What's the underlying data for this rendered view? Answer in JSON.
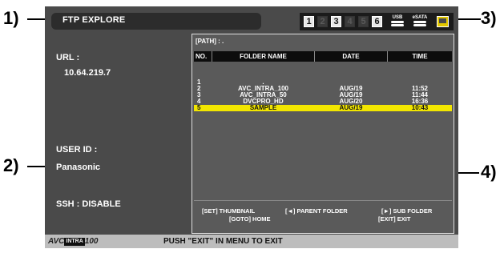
{
  "callouts": {
    "c1": "1)",
    "c2": "2)",
    "c3": "3)",
    "c4": "4)"
  },
  "title": "FTP EXPLORE",
  "status": {
    "slots": [
      {
        "label": "1",
        "active": true
      },
      {
        "label": "2",
        "active": false
      },
      {
        "label": "3",
        "active": true
      },
      {
        "label": "4",
        "active": false
      },
      {
        "label": "5",
        "active": false
      },
      {
        "label": "6",
        "active": true
      }
    ],
    "usb_label": "USB",
    "esata_label": "eSATA",
    "accent_color": "#e3c800"
  },
  "info": {
    "url_label": "URL :",
    "url_value": "10.64.219.7",
    "user_label": "USER ID :",
    "user_value": "Panasonic",
    "ssh_label": "SSH : DISABLE"
  },
  "browser": {
    "path": "[PATH] : .",
    "columns": [
      "NO.",
      "FOLDER NAME",
      "DATE",
      "TIME"
    ],
    "rows": [
      {
        "no": "1",
        "name": ".",
        "date": "",
        "time": "",
        "selected": false
      },
      {
        "no": "2",
        "name": "AVC_INTRA_100",
        "date": "AUG/19",
        "time": "11:52",
        "selected": false
      },
      {
        "no": "3",
        "name": "AVC_INTRA_50",
        "date": "AUG/19",
        "time": "11:44",
        "selected": false
      },
      {
        "no": "4",
        "name": "DVCPRO_HD",
        "date": "AUG/20",
        "time": "16:36",
        "selected": false
      },
      {
        "no": "5",
        "name": "SAMPLE",
        "date": "AUG/19",
        "time": "10:43",
        "selected": true
      }
    ],
    "hints": {
      "thumbnail": "[SET] THUMBNAIL",
      "parent": "[◄] PARENT FOLDER",
      "sub": "[►] SUB FOLDER",
      "home": "[GOTO] HOME",
      "exit": "[EXIT] EXIT"
    },
    "selected_color": "#f2e600"
  },
  "footer": {
    "logo_prefix": "AVC",
    "logo_box": "INTRA",
    "logo_suffix": "100",
    "message": "PUSH \"EXIT\" IN MENU TO EXIT"
  }
}
